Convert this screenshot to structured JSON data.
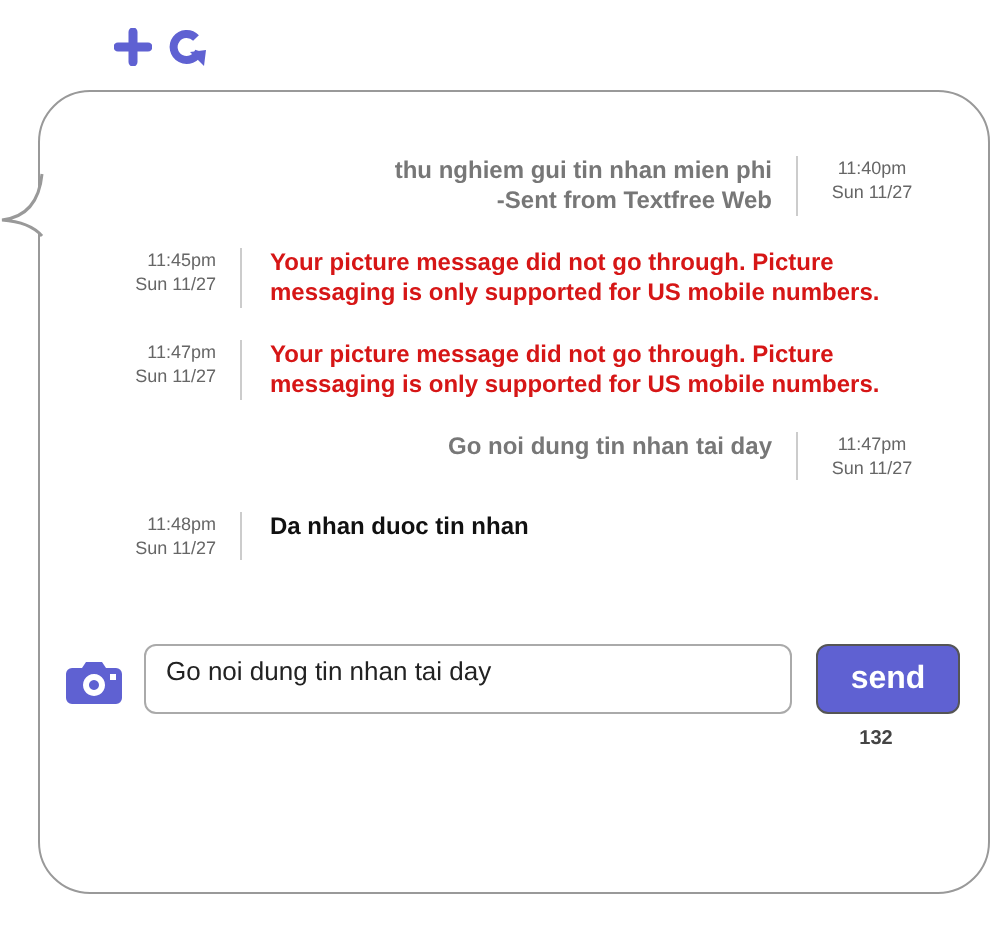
{
  "messages": [
    {
      "kind": "outgoing",
      "error": false,
      "text": "thu nghiem gui tin nhan mien phi\n-Sent from Textfree Web",
      "time": "11:40pm",
      "date": "Sun 11/27"
    },
    {
      "kind": "incoming",
      "error": true,
      "text": "Your picture message did not go through. Picture messaging is only supported for US mobile numbers.",
      "time": "11:45pm",
      "date": "Sun 11/27"
    },
    {
      "kind": "incoming",
      "error": true,
      "text": "Your picture message did not go through. Picture messaging is only supported for US mobile numbers.",
      "time": "11:47pm",
      "date": "Sun 11/27"
    },
    {
      "kind": "outgoing",
      "error": false,
      "text": "Go noi dung tin nhan tai day",
      "time": "11:47pm",
      "date": "Sun 11/27"
    },
    {
      "kind": "incoming",
      "error": false,
      "text": "Da nhan duoc tin nhan",
      "time": "11:48pm",
      "date": "Sun 11/27"
    }
  ],
  "composer": {
    "value": "Go noi dung tin nhan tai day",
    "send_label": "send",
    "counter": "132"
  }
}
